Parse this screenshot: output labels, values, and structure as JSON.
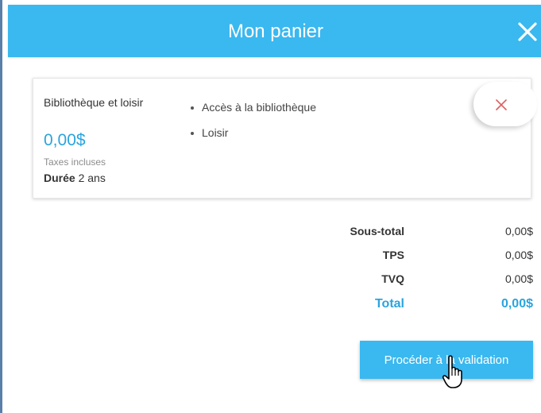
{
  "header": {
    "title": "Mon panier",
    "close_icon": "close-icon",
    "background": "#3ab8f0"
  },
  "cart_item": {
    "name": "Bibliothèque et loisir",
    "price": "0,00$",
    "taxes_note": "Taxes incluses",
    "duration_label": "Durée",
    "duration_value": "2 ans",
    "features": [
      "Accès à la bibliothèque",
      "Loisir"
    ],
    "remove_icon": "close-icon",
    "price_color": "#2aa4de"
  },
  "totals": {
    "subtotal_label": "Sous-total",
    "subtotal_value": "0,00$",
    "tps_label": "TPS",
    "tps_value": "0,00$",
    "tvq_label": "TVQ",
    "tvq_value": "0,00$",
    "total_label": "Total",
    "total_value": "0,00$"
  },
  "actions": {
    "proceed_label": "Procéder à la validation"
  },
  "cursor": {
    "icon": "hand-pointer-icon"
  }
}
